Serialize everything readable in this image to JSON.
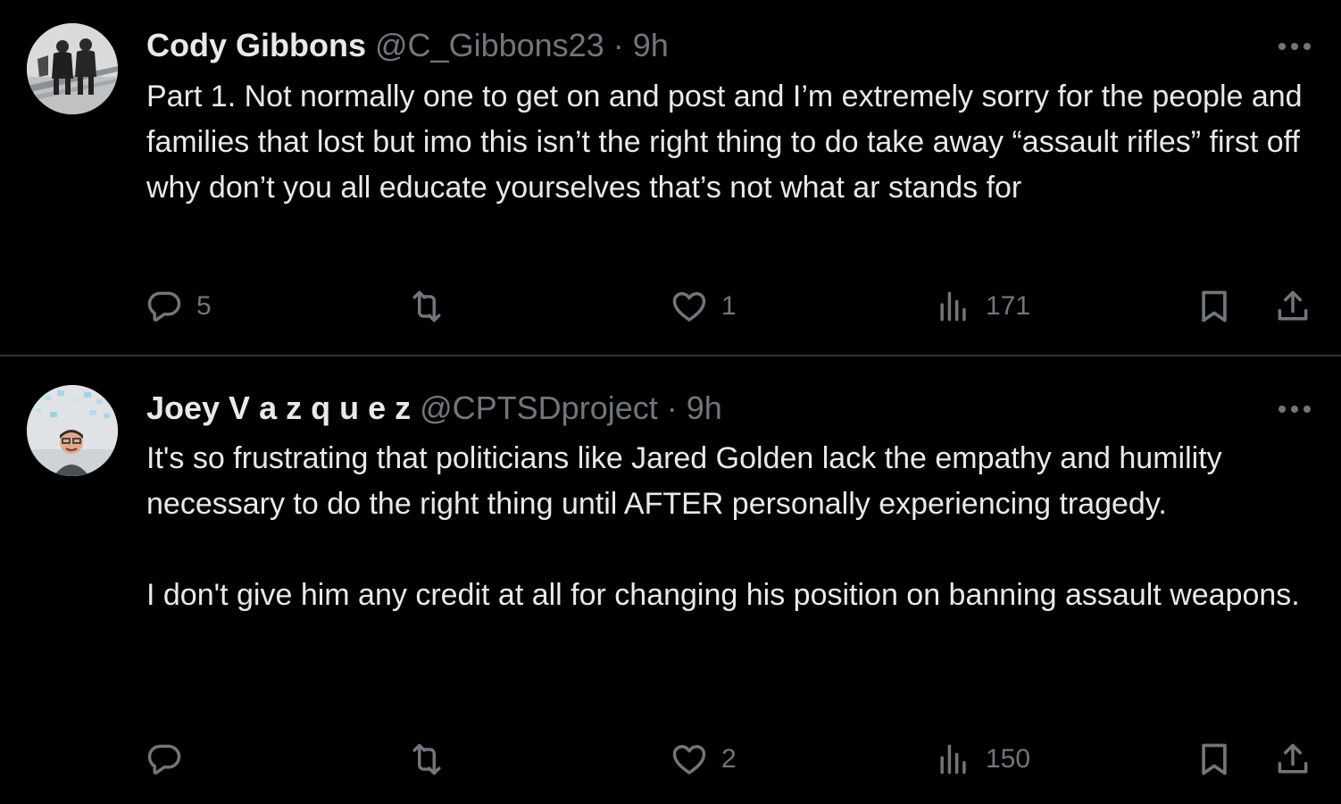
{
  "tweets": [
    {
      "name": "Cody Gibbons",
      "handle": "@C_Gibbons23",
      "separator": "·",
      "time": "9h",
      "paragraphs": [
        "Part 1. Not normally one to get on and post and I’m extremely sorry for the people and families that lost but imo this isn’t the right thing to do take away “assault rifles” first off why don’t you all educate yourselves that’s not what ar stands for"
      ],
      "replies": "5",
      "retweets": "",
      "likes": "1",
      "views": "171",
      "icons": {
        "avatar": "avatar-photo",
        "more": "more-dots-icon",
        "reply": "reply-bubble-icon",
        "retweet": "retweet-arrows-icon",
        "like": "heart-icon",
        "views": "views-bar-chart-icon",
        "bookmark": "bookmark-icon",
        "share": "share-upload-icon"
      }
    },
    {
      "name": "Joey V a z q u e z",
      "handle": "@CPTSDproject",
      "separator": "·",
      "time": "9h",
      "paragraphs": [
        "It's so frustrating that politicians like Jared Golden lack the empathy and humility necessary to do the right thing until AFTER personally experiencing tragedy.",
        "I don't give him any credit at all for changing his position on banning assault weapons."
      ],
      "replies": "",
      "retweets": "",
      "likes": "2",
      "views": "150",
      "icons": {
        "avatar": "avatar-photo",
        "more": "more-dots-icon",
        "reply": "reply-bubble-icon",
        "retweet": "retweet-arrows-icon",
        "like": "heart-icon",
        "views": "views-bar-chart-icon",
        "bookmark": "bookmark-icon",
        "share": "share-upload-icon"
      }
    }
  ],
  "colors": {
    "background": "#000000",
    "text_primary": "#e7e9ea",
    "text_secondary": "#71767b",
    "divider": "#2f3336"
  }
}
